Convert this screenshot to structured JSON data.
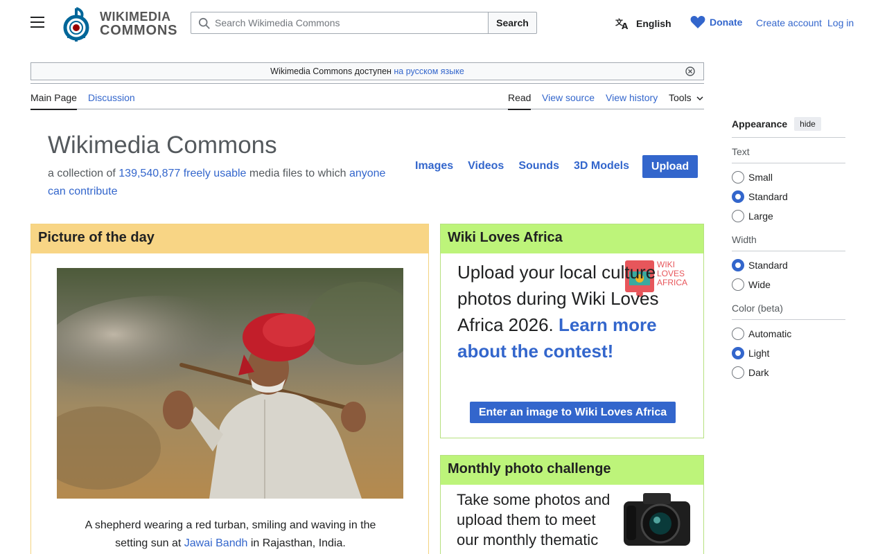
{
  "header": {
    "logo_line1": "WIKIMEDIA",
    "logo_line2": "COMMONS",
    "search_placeholder": "Search Wikimedia Commons",
    "search_button": "Search",
    "language": "English",
    "donate": "Donate",
    "create_account": "Create account",
    "log_in": "Log in"
  },
  "notice": {
    "text": "Wikimedia Commons доступен ",
    "link": "на русском языке"
  },
  "tabs": {
    "left": [
      "Main Page",
      "Discussion"
    ],
    "right": [
      "Read",
      "View source",
      "View history",
      "Tools"
    ]
  },
  "hero": {
    "title": "Wikimedia Commons",
    "sub_prefix": "a collection of ",
    "count": "139,540,877",
    "freely_usable": "freely usable",
    "sub_mid": " media files to which ",
    "anyone_contribute": "anyone can contribute",
    "nav": [
      "Images",
      "Videos",
      "Sounds",
      "3D Models"
    ],
    "upload": "Upload"
  },
  "potd": {
    "heading": "Picture of the day",
    "caption_prefix": "A shepherd wearing a red turban, smiling and waving in the setting sun at ",
    "caption_link": "Jawai Bandh",
    "caption_suffix": " in Rajasthan, India."
  },
  "wla": {
    "heading": "Wiki Loves Africa",
    "text": "Upload your local culture photos during Wiki Loves Africa 2026. ",
    "link": "Learn more about the contest!",
    "logo_line1": "WIKI",
    "logo_line2": "LOVES",
    "logo_line3": "AFRICA",
    "button": "Enter an image to Wiki Loves Africa"
  },
  "mpc": {
    "heading": "Monthly photo challenge",
    "text": "Take some photos and upload them to meet our monthly thematic challenge..."
  },
  "appearance": {
    "title": "Appearance",
    "hide": "hide",
    "sections": [
      {
        "title": "Text",
        "options": [
          "Small",
          "Standard",
          "Large"
        ],
        "selected": "Standard"
      },
      {
        "title": "Width",
        "options": [
          "Standard",
          "Wide"
        ],
        "selected": "Standard"
      },
      {
        "title": "Color (beta)",
        "options": [
          "Automatic",
          "Light",
          "Dark"
        ],
        "selected": "Light"
      }
    ]
  },
  "colors": {
    "link": "#3366cc",
    "potd_header": "#f8d585",
    "green_header": "#bdf47a"
  }
}
